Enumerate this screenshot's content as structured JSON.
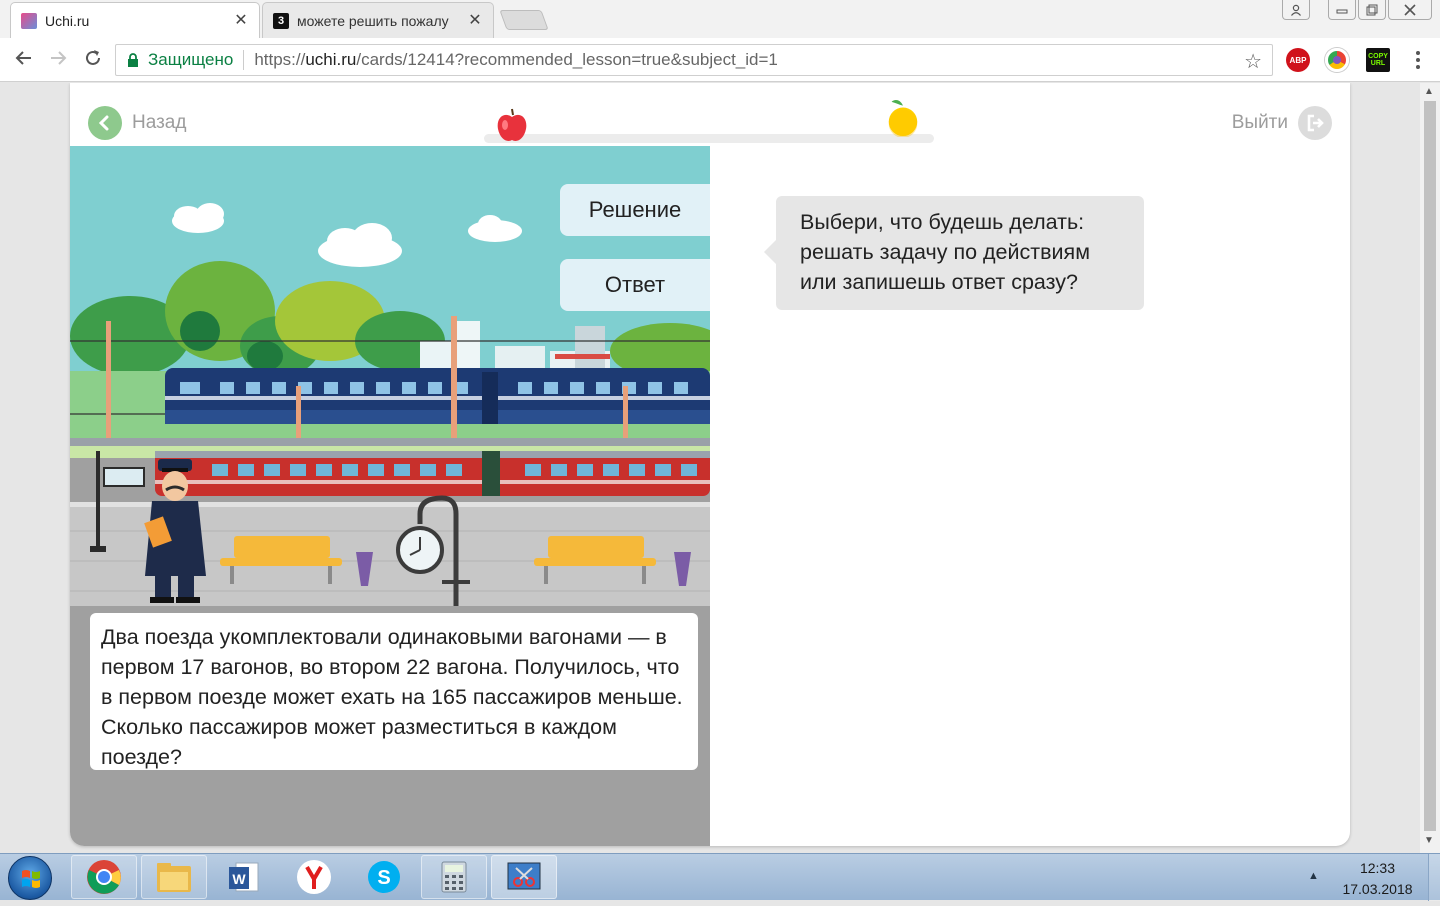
{
  "browser": {
    "tabs": [
      {
        "title": "Uchi.ru",
        "active": true
      },
      {
        "title": "можете решить пожалу",
        "active": false
      }
    ],
    "secure_label": "Защищено",
    "url_scheme": "https://",
    "url_domain": "uchi.ru",
    "url_path": "/cards/12414?recommended_lesson=true&subject_id=1",
    "ext_abp": "ABP",
    "ext_copy": "COPY URL"
  },
  "lesson": {
    "back_label": "Назад",
    "exit_label": "Выйти",
    "options": [
      {
        "label": "Решение"
      },
      {
        "label": "Ответ"
      }
    ],
    "task_text": "Два поезда укомплектовали одинаковыми вагонами — в первом 17 вагонов, во втором 22 вагона. Получилось, что в первом поезде может ехать на 165 пассажиров меньше. Сколько пассажиров может разместиться в каждом поезде?",
    "prompt_text": "Выбери, что будешь делать: решать задачу по действиям или запишешь ответ сразу?"
  },
  "taskbar": {
    "time": "12:33",
    "date": "17.03.2018"
  },
  "colors": {
    "accent_green": "#8ec98d",
    "sky": "#7fcfd0",
    "train_blue": "#1d3a73",
    "train_red": "#c8302c",
    "option_bg": "#e1f1f7"
  }
}
